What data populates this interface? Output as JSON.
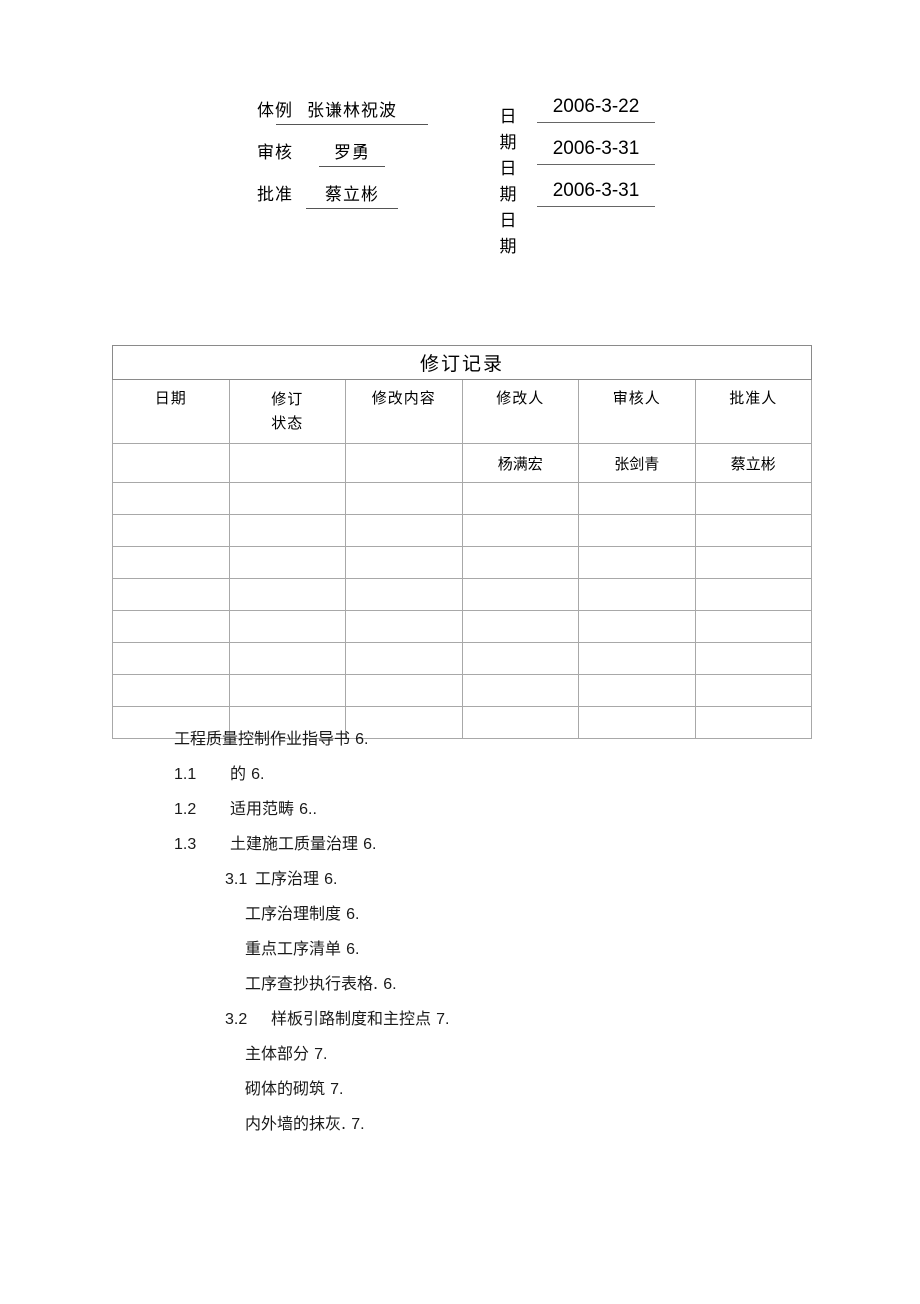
{
  "signoff": {
    "rows": [
      {
        "label": "体例",
        "name": "张谦林祝波",
        "name_width": "wide",
        "date_label": "日期",
        "date": "2006-3-22"
      },
      {
        "label": "审核",
        "name": "罗勇",
        "name_width": "narrow",
        "date_label": "日期",
        "date": "2006-3-31"
      },
      {
        "label": "批准",
        "name": "蔡立彬",
        "name_width": "mid",
        "date_label": "日期",
        "date": "2006-3-31"
      }
    ],
    "date_label_chars": [
      "日",
      "期",
      "日",
      "期",
      "日",
      "期"
    ]
  },
  "revision_table": {
    "title": "修订记录",
    "columns": [
      {
        "header": "日期",
        "header2": ""
      },
      {
        "header": "修订",
        "header2": "状态"
      },
      {
        "header": "修改内容",
        "header2": ""
      },
      {
        "header": "修改人",
        "header2": ""
      },
      {
        "header": "审核人",
        "header2": ""
      },
      {
        "header": "批准人",
        "header2": ""
      }
    ],
    "rows": [
      {
        "date": "",
        "status": "",
        "content": "",
        "editor": "杨满宏",
        "reviewer": "张剑青",
        "approver": "蔡立彬"
      },
      {
        "date": "",
        "status": "",
        "content": "",
        "editor": "",
        "reviewer": "",
        "approver": ""
      },
      {
        "date": "",
        "status": "",
        "content": "",
        "editor": "",
        "reviewer": "",
        "approver": ""
      },
      {
        "date": "",
        "status": "",
        "content": "",
        "editor": "",
        "reviewer": "",
        "approver": ""
      },
      {
        "date": "",
        "status": "",
        "content": "",
        "editor": "",
        "reviewer": "",
        "approver": ""
      },
      {
        "date": "",
        "status": "",
        "content": "",
        "editor": "",
        "reviewer": "",
        "approver": ""
      },
      {
        "date": "",
        "status": "",
        "content": "",
        "editor": "",
        "reviewer": "",
        "approver": ""
      },
      {
        "date": "",
        "status": "",
        "content": "",
        "editor": "",
        "reviewer": "",
        "approver": ""
      },
      {
        "date": "",
        "status": "",
        "content": "",
        "editor": "",
        "reviewer": "",
        "approver": ""
      }
    ]
  },
  "toc": {
    "entries": [
      {
        "number": "",
        "text": "工程质量控制作业指导书",
        "page": "6.",
        "level": 0
      },
      {
        "number": "1.1",
        "text": "的",
        "page": "6.",
        "level": 1
      },
      {
        "number": "1.2",
        "text": "适用范畴",
        "page": "6..",
        "level": 1
      },
      {
        "number": "1.3",
        "text": "土建施工质量治理",
        "page": "6.",
        "level": 1
      },
      {
        "number": "3.1",
        "text": "工序治理",
        "page": "6.",
        "level": 2
      },
      {
        "number": "",
        "text": "工序治理制度",
        "page": "6.",
        "level": 3
      },
      {
        "number": "",
        "text": "重点工序清单",
        "page": "6.",
        "level": 3
      },
      {
        "number": "",
        "text": "工序查抄执行表格.",
        "page": "6.",
        "level": 3
      },
      {
        "number": "3.2",
        "text": "样板引路制度和主控点",
        "page": "7.",
        "level": 4
      },
      {
        "number": "",
        "text": "主体部分",
        "page": "7.",
        "level": 3
      },
      {
        "number": "",
        "text": "砌体的砌筑",
        "page": "7.",
        "level": 3
      },
      {
        "number": "",
        "text": "内外墙的抹灰.",
        "page": "7.",
        "level": 3
      }
    ]
  }
}
